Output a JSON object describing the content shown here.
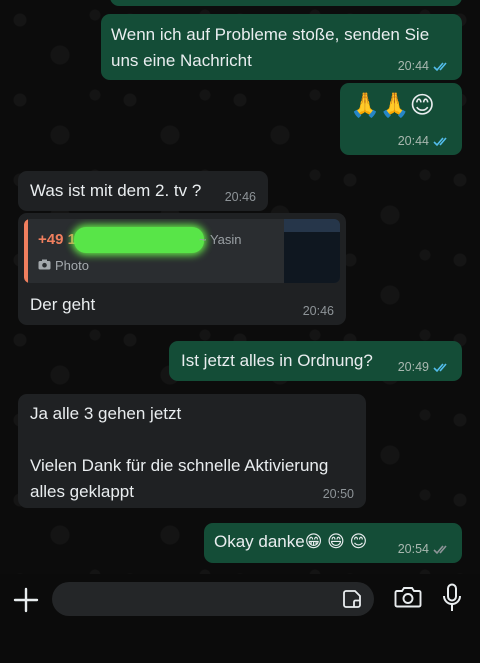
{
  "messages": [
    {
      "dir": "out",
      "text": "Wenn ich auf Probleme stoße, senden Sie uns eine Nachricht",
      "time": "20:44"
    },
    {
      "dir": "out",
      "text": "🙏🙏😊",
      "time": "20:44"
    },
    {
      "dir": "in",
      "text": "Was ist mit dem 2. tv ?",
      "time": "20:46"
    },
    {
      "dir": "in",
      "quote": {
        "name": "+49 1",
        "author": "~ Yasin",
        "media": "Photo"
      },
      "text": "Der geht",
      "time": "20:46"
    },
    {
      "dir": "out",
      "text": "Ist jetzt alles in Ordnung?",
      "time": "20:49"
    },
    {
      "dir": "in",
      "text": "Ja alle 3 gehen jetzt\n\nVielen Dank für die schnelle Aktivierung alles geklappt",
      "time": "20:50"
    },
    {
      "dir": "out",
      "text": "Okay danke😁 😄 😊",
      "time": "20:54"
    }
  ],
  "composer": {
    "placeholder": ""
  },
  "icons": {
    "plus": "plus-icon",
    "sticker": "sticker-icon",
    "camera": "camera-icon",
    "mic": "microphone-icon",
    "read": "double-check-icon"
  },
  "colors": {
    "outgoing": "#144d37",
    "incoming": "#1f2123",
    "read_ticks": "#53bdeb",
    "quote_accent": "#f07f5e"
  }
}
